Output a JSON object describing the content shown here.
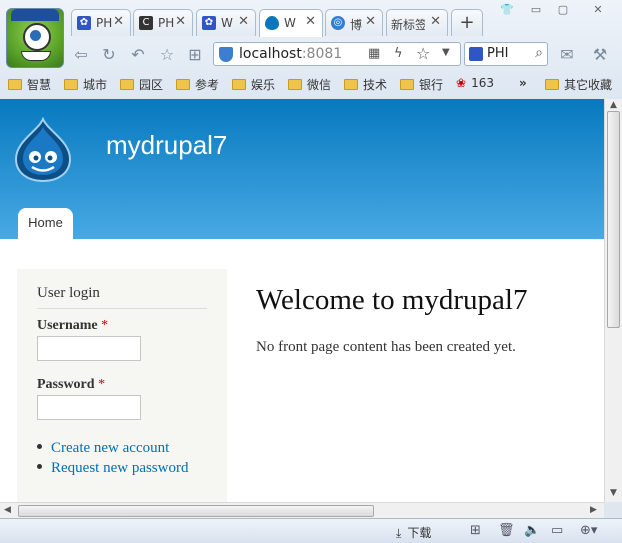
{
  "tabs": [
    {
      "label": "PH",
      "icon": "paw-icon",
      "color": "#2f56c4",
      "active": false
    },
    {
      "label": "PH",
      "icon": "cnblogs-icon",
      "color": "#333333",
      "active": false
    },
    {
      "label": "W",
      "icon": "paw-icon",
      "color": "#2f56c4",
      "active": false
    },
    {
      "label": "W",
      "icon": "drupal-icon",
      "color": "#0a77bd",
      "active": true
    },
    {
      "label": "博",
      "icon": "globe-icon",
      "color": "#2f7fd6",
      "active": false
    },
    {
      "label": "新标签",
      "icon": "",
      "color": "",
      "active": false
    }
  ],
  "new_tab_label": "+",
  "window_controls": [
    "minimize",
    "maximize",
    "close"
  ],
  "address": {
    "host": "localhost",
    "port": ":8081"
  },
  "search": {
    "value": "PHI"
  },
  "bookmarks": [
    "智慧",
    "城市",
    "园区",
    "参考",
    "娱乐",
    "微信",
    "技术",
    "银行",
    "163",
    "»",
    "其它收藏"
  ],
  "page": {
    "site_name": "mydrupal7",
    "nav": {
      "home": "Home"
    },
    "login": {
      "title": "User login",
      "username_label": "Username",
      "password_label": "Password",
      "required_mark": "*",
      "links": [
        "Create new account",
        "Request new password"
      ]
    },
    "welcome_title": "Welcome to mydrupal7",
    "empty_message": "No front page content has been created yet."
  },
  "status": {
    "download_label": "下载"
  },
  "colors": {
    "header_top": "#0779bf",
    "header_bottom": "#48a9e4",
    "link": "#0071b3",
    "required": "#cc0000"
  }
}
